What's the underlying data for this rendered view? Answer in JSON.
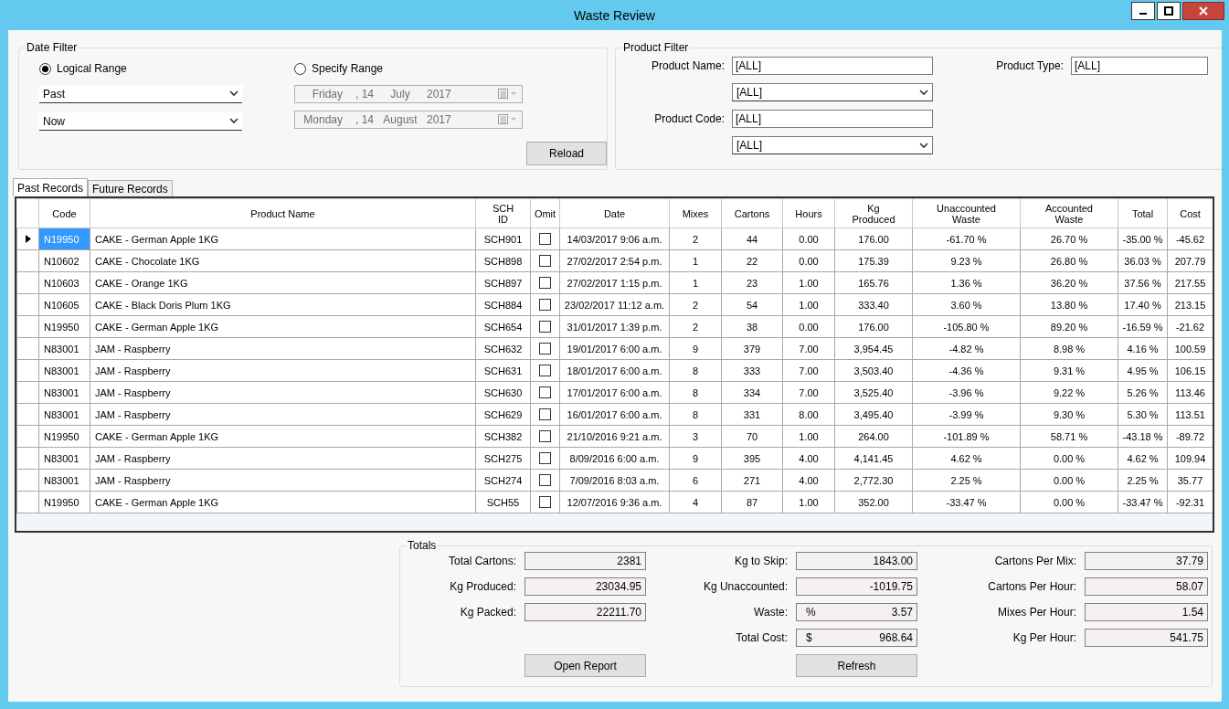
{
  "window": {
    "title": "Waste Review"
  },
  "date_filter": {
    "legend": "Date Filter",
    "logical_range": {
      "label": "Logical Range",
      "selected": true,
      "dropdowns": [
        "Past",
        "Now"
      ]
    },
    "specify_range": {
      "label": "Specify Range",
      "selected": false,
      "date_pickers": [
        {
          "disabled": true,
          "parts": [
            "Friday",
            ", 14",
            "July",
            "2017"
          ]
        },
        {
          "disabled": true,
          "parts": [
            "Monday",
            ", 14",
            "August",
            "2017"
          ]
        }
      ]
    },
    "reload_button": "Reload"
  },
  "product_filter": {
    "legend": "Product Filter",
    "fields": [
      {
        "kind": "text",
        "label": "Product Name:",
        "value": "[ALL]"
      },
      {
        "kind": "dropdown",
        "value": "[ALL]"
      },
      {
        "kind": "text",
        "label": "Product Code:",
        "value": "[ALL]"
      },
      {
        "kind": "dropdown",
        "value": "[ALL]"
      }
    ],
    "product_type": {
      "label": "Product Type:",
      "value": "[ALL]"
    }
  },
  "tabs": [
    {
      "label": "Past Records",
      "selected": true
    },
    {
      "label": "Future Records",
      "selected": false
    }
  ],
  "table": {
    "columns": [
      {
        "label": "Code",
        "kind": "text"
      },
      {
        "label": "Product Name",
        "kind": "text"
      },
      {
        "label": "SCH\nID",
        "kind": "number"
      },
      {
        "label": "Omit",
        "kind": "checkbox"
      },
      {
        "label": "Date",
        "kind": "number"
      },
      {
        "label": "Mixes",
        "kind": "number"
      },
      {
        "label": "Cartons",
        "kind": "number"
      },
      {
        "label": "Hours",
        "kind": "number"
      },
      {
        "label": "Kg\nProduced",
        "kind": "number"
      },
      {
        "label": "Unaccounted\nWaste",
        "kind": "number"
      },
      {
        "label": "Accounted\nWaste",
        "kind": "number"
      },
      {
        "label": "Total",
        "kind": "number"
      },
      {
        "label": "Cost",
        "kind": "number"
      }
    ],
    "rows": [
      {
        "selected": true,
        "cells": [
          "N19950",
          "CAKE - German Apple 1KG",
          "SCH901",
          {
            "checked": false
          },
          "14/03/2017 9:06 a.m.",
          "2",
          "44",
          "0.00",
          "176.00",
          "-61.70 %",
          "26.70 %",
          "-35.00 %",
          "-45.62"
        ]
      },
      {
        "selected": false,
        "cells": [
          "N10602",
          "CAKE - Chocolate 1KG",
          "SCH898",
          {
            "checked": false
          },
          "27/02/2017 2:54 p.m.",
          "1",
          "22",
          "0.00",
          "175.39",
          "9.23 %",
          "26.80 %",
          "36.03 %",
          "207.79"
        ]
      },
      {
        "selected": false,
        "cells": [
          "N10603",
          "CAKE - Orange 1KG",
          "SCH897",
          {
            "checked": false
          },
          "27/02/2017 1:15 p.m.",
          "1",
          "23",
          "1.00",
          "165.76",
          "1.36 %",
          "36.20 %",
          "37.56 %",
          "217.55"
        ]
      },
      {
        "selected": false,
        "cells": [
          "N10605",
          "CAKE - Black Doris Plum 1KG",
          "SCH884",
          {
            "checked": false
          },
          "23/02/2017 11:12 a.m.",
          "2",
          "54",
          "1.00",
          "333.40",
          "3.60 %",
          "13.80 %",
          "17.40 %",
          "213.15"
        ]
      },
      {
        "selected": false,
        "cells": [
          "N19950",
          "CAKE - German Apple 1KG",
          "SCH654",
          {
            "checked": false
          },
          "31/01/2017 1:39 p.m.",
          "2",
          "38",
          "0.00",
          "176.00",
          "-105.80 %",
          "89.20 %",
          "-16.59 %",
          "-21.62"
        ]
      },
      {
        "selected": false,
        "cells": [
          "N83001",
          "JAM - Raspberry",
          "SCH632",
          {
            "checked": false
          },
          "19/01/2017 6:00 a.m.",
          "9",
          "379",
          "7.00",
          "3,954.45",
          "-4.82 %",
          "8.98 %",
          "4.16 %",
          "100.59"
        ]
      },
      {
        "selected": false,
        "cells": [
          "N83001",
          "JAM - Raspberry",
          "SCH631",
          {
            "checked": false
          },
          "18/01/2017 6:00 a.m.",
          "8",
          "333",
          "7.00",
          "3,503.40",
          "-4.36 %",
          "9.31 %",
          "4.95 %",
          "106.15"
        ]
      },
      {
        "selected": false,
        "cells": [
          "N83001",
          "JAM - Raspberry",
          "SCH630",
          {
            "checked": false
          },
          "17/01/2017 6:00 a.m.",
          "8",
          "334",
          "7.00",
          "3,525.40",
          "-3.96 %",
          "9.22 %",
          "5.26 %",
          "113.46"
        ]
      },
      {
        "selected": false,
        "cells": [
          "N83001",
          "JAM - Raspberry",
          "SCH629",
          {
            "checked": false
          },
          "16/01/2017 6:00 a.m.",
          "8",
          "331",
          "8.00",
          "3,495.40",
          "-3.99 %",
          "9.30 %",
          "5.30 %",
          "113.51"
        ]
      },
      {
        "selected": false,
        "cells": [
          "N19950",
          "CAKE - German Apple 1KG",
          "SCH382",
          {
            "checked": false
          },
          "21/10/2016 9:21 a.m.",
          "3",
          "70",
          "1.00",
          "264.00",
          "-101.89 %",
          "58.71 %",
          "-43.18 %",
          "-89.72"
        ]
      },
      {
        "selected": false,
        "cells": [
          "N83001",
          "JAM - Raspberry",
          "SCH275",
          {
            "checked": false
          },
          "8/09/2016 6:00 a.m.",
          "9",
          "395",
          "4.00",
          "4,141.45",
          "4.62 %",
          "0.00 %",
          "4.62 %",
          "109.94"
        ]
      },
      {
        "selected": false,
        "cells": [
          "N83001",
          "JAM - Raspberry",
          "SCH274",
          {
            "checked": false
          },
          "7/09/2016 8:03 a.m.",
          "6",
          "271",
          "4.00",
          "2,772.30",
          "2.25 %",
          "0.00 %",
          "2.25 %",
          "35.77"
        ]
      },
      {
        "selected": false,
        "cells": [
          "N19950",
          "CAKE - German Apple 1KG",
          "SCH55",
          {
            "checked": false
          },
          "12/07/2016 9:36 a.m.",
          "4",
          "87",
          "1.00",
          "352.00",
          "-33.47 %",
          "0.00 %",
          "-33.47 %",
          "-92.31"
        ]
      }
    ]
  },
  "totals": {
    "legend": "Totals",
    "columns": [
      {
        "fields": [
          {
            "label": "Total Cartons:",
            "value": "2381"
          },
          {
            "label": "Kg Produced:",
            "value": "23034.95"
          },
          {
            "label": "Kg Packed:",
            "value": "22211.70"
          }
        ],
        "button": "Open Report"
      },
      {
        "fields": [
          {
            "label": "Kg to Skip:",
            "value": "1843.00"
          },
          {
            "label": "Kg Unaccounted:",
            "value": "-1019.75"
          },
          {
            "label": "Waste:",
            "prefix": "%",
            "value": "3.57"
          },
          {
            "label": "Total Cost:",
            "prefix": "$",
            "value": "968.64"
          }
        ],
        "button": "Refresh"
      },
      {
        "fields": [
          {
            "label": "Cartons Per Mix:",
            "value": "37.79"
          },
          {
            "label": "Cartons Per Hour:",
            "value": "58.07"
          },
          {
            "label": "Mixes Per Hour:",
            "value": "1.54"
          },
          {
            "label": "Kg Per Hour:",
            "value": "541.75"
          }
        ]
      }
    ]
  }
}
